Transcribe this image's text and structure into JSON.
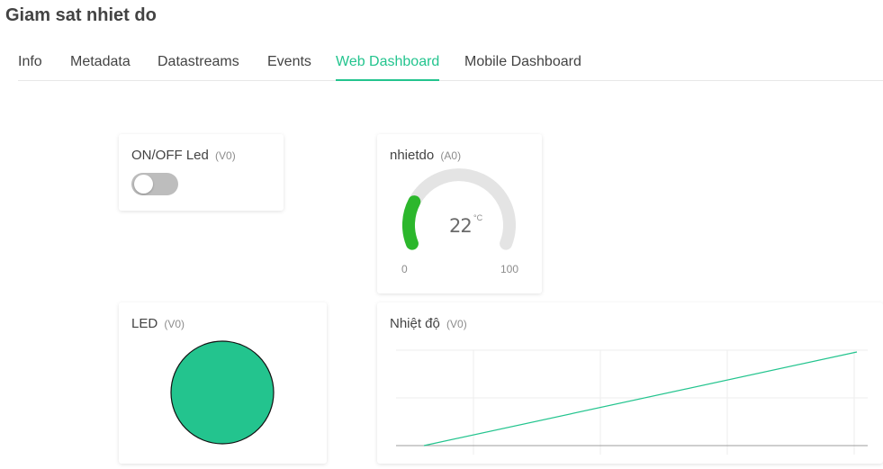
{
  "header": {
    "title": "Giam sat nhiet do"
  },
  "tabs": [
    {
      "label": "Info",
      "active": false
    },
    {
      "label": "Metadata",
      "active": false
    },
    {
      "label": "Datastreams",
      "active": false
    },
    {
      "label": "Events",
      "active": false
    },
    {
      "label": "Web Dashboard",
      "active": true
    },
    {
      "label": "Mobile Dashboard",
      "active": false
    }
  ],
  "colors": {
    "accent": "#23c48e",
    "gauge_fill": "#2cb72c",
    "gauge_track": "#e4e4e4",
    "led_on": "#23c48e",
    "switch_off": "#bdbdbd"
  },
  "widgets": {
    "switch": {
      "title": "ON/OFF Led",
      "pin": "(V0)",
      "state": "off"
    },
    "gauge": {
      "title": "nhietdo",
      "pin": "(A0)",
      "value": "22",
      "unit": "°C",
      "min": "0",
      "max": "100",
      "level": 0.22
    },
    "led": {
      "title": "LED",
      "pin": "(V0)",
      "state": "on"
    },
    "chart": {
      "title": "Nhiệt độ",
      "pin": "(V0)"
    }
  },
  "chart_data": {
    "type": "line",
    "title": "Nhiệt độ",
    "series": [
      {
        "values": [
          0,
          1
        ]
      }
    ],
    "grid": true,
    "legend": "none"
  }
}
